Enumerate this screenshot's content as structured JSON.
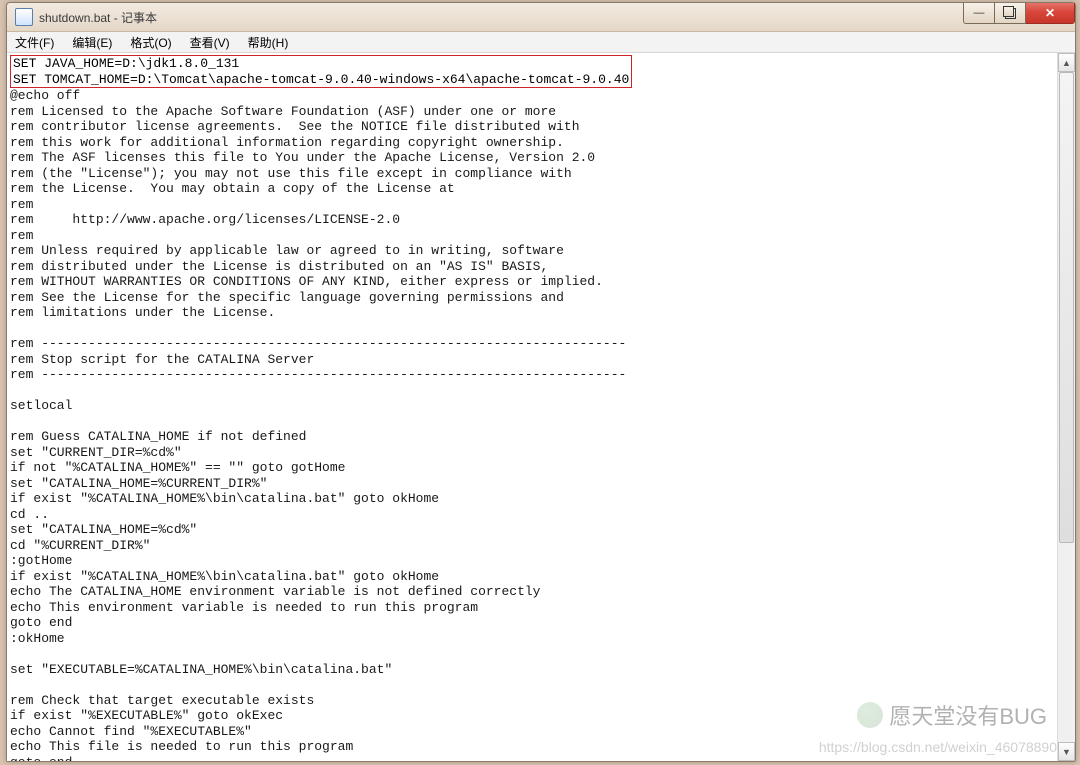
{
  "window": {
    "title": "shutdown.bat - 记事本"
  },
  "menu": {
    "file": "文件(F)",
    "edit": "编辑(E)",
    "format": "格式(O)",
    "view": "查看(V)",
    "help": "帮助(H)"
  },
  "editor": {
    "highlighted": "SET JAVA_HOME=D:\\jdk1.8.0_131\nSET TOMCAT_HOME=D:\\Tomcat\\apache-tomcat-9.0.40-windows-x64\\apache-tomcat-9.0.40",
    "body": "@echo off\nrem Licensed to the Apache Software Foundation (ASF) under one or more\nrem contributor license agreements.  See the NOTICE file distributed with\nrem this work for additional information regarding copyright ownership.\nrem The ASF licenses this file to You under the Apache License, Version 2.0\nrem (the \"License\"); you may not use this file except in compliance with\nrem the License.  You may obtain a copy of the License at\nrem\nrem     http://www.apache.org/licenses/LICENSE-2.0\nrem\nrem Unless required by applicable law or agreed to in writing, software\nrem distributed under the License is distributed on an \"AS IS\" BASIS,\nrem WITHOUT WARRANTIES OR CONDITIONS OF ANY KIND, either express or implied.\nrem See the License for the specific language governing permissions and\nrem limitations under the License.\n\nrem ---------------------------------------------------------------------------\nrem Stop script for the CATALINA Server\nrem ---------------------------------------------------------------------------\n\nsetlocal\n\nrem Guess CATALINA_HOME if not defined\nset \"CURRENT_DIR=%cd%\"\nif not \"%CATALINA_HOME%\" == \"\" goto gotHome\nset \"CATALINA_HOME=%CURRENT_DIR%\"\nif exist \"%CATALINA_HOME%\\bin\\catalina.bat\" goto okHome\ncd ..\nset \"CATALINA_HOME=%cd%\"\ncd \"%CURRENT_DIR%\"\n:gotHome\nif exist \"%CATALINA_HOME%\\bin\\catalina.bat\" goto okHome\necho The CATALINA_HOME environment variable is not defined correctly\necho This environment variable is needed to run this program\ngoto end\n:okHome\n\nset \"EXECUTABLE=%CATALINA_HOME%\\bin\\catalina.bat\"\n\nrem Check that target executable exists\nif exist \"%EXECUTABLE%\" goto okExec\necho Cannot find \"%EXECUTABLE%\"\necho This file is needed to run this program\ngoto end"
  },
  "watermark": {
    "wechat": "愿天堂没有BUG",
    "csdn": "https://blog.csdn.net/weixin_46078890"
  }
}
